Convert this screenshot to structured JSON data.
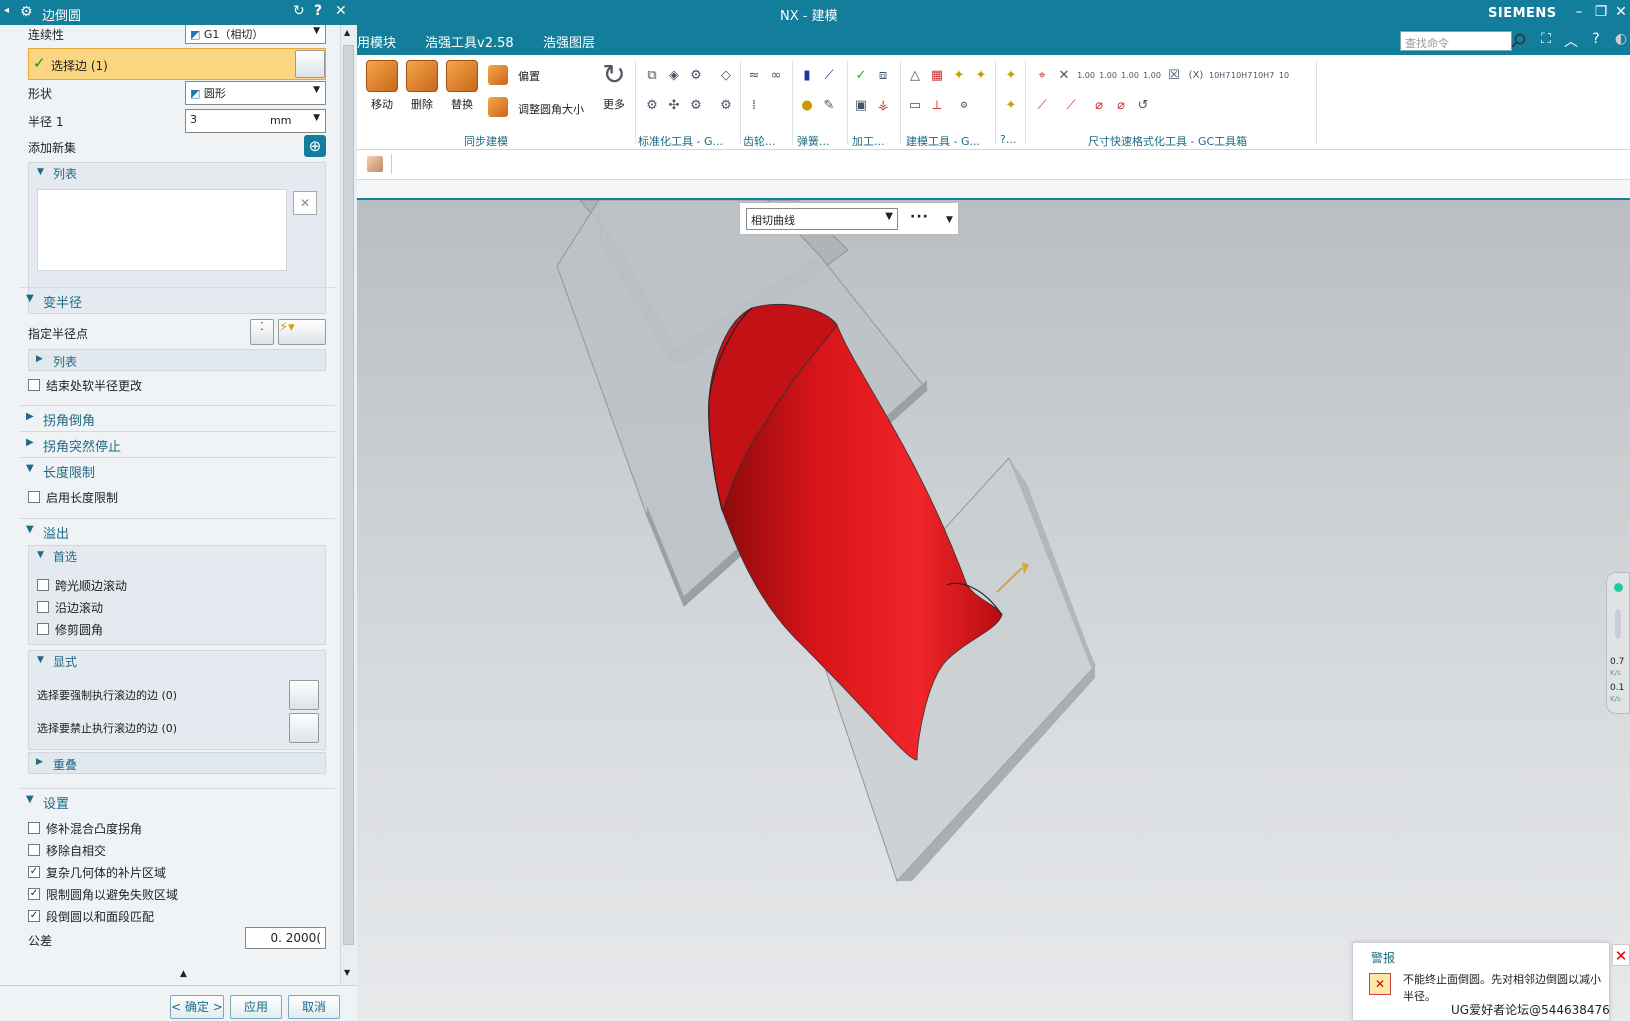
{
  "window": {
    "title": "NX - 建模",
    "brand": "SIEMENS"
  },
  "menu": {
    "tabs": [
      "用模块",
      "浩强工具v2.58",
      "浩强图层"
    ],
    "search_placeholder": "查找命令"
  },
  "ribbon": {
    "big_buttons": [
      "移动",
      "删除",
      "替换"
    ],
    "small_buttons": [
      "偏置",
      "调整圆角大小"
    ],
    "more": "更多",
    "groups": [
      "同步建模",
      "标准化工具 - G...",
      "齿轮...",
      "弹簧...",
      "加工...",
      "建模工具 - G...",
      "?...",
      "尺寸快速格式化工具 - GC工具箱"
    ]
  },
  "selection_bar": {
    "filter": "相切曲线",
    "more": "···"
  },
  "dialog": {
    "title": "边倒圆",
    "continuity_label": "连续性",
    "continuity_value": "G1（相切）",
    "select_edge_label": "选择边 (1)",
    "shape_label": "形状",
    "shape_value": "圆形",
    "radius_label": "半径 1",
    "radius_value": "3",
    "radius_unit": "mm",
    "add_set_label": "添加新集",
    "list_label": "列表",
    "var_radius": {
      "title": "变半径",
      "specify_points": "指定半径点",
      "list": "列表",
      "smooth": "结束处软半径更改"
    },
    "corner_setback": "拐角倒角",
    "corner_stop": "拐角突然停止",
    "length_limit": {
      "title": "长度限制",
      "enable": "启用长度限制"
    },
    "overflow": {
      "title": "溢出",
      "preferred": "首选",
      "opt1": "跨光顺边滚动",
      "opt2": "沿边滚动",
      "opt3": "修剪圆角",
      "explicit": "显式",
      "force_label": "选择要强制执行滚边的边 (0)",
      "forbid_label": "选择要禁止执行滚边的边 (0)",
      "overlap": "重叠"
    },
    "settings": {
      "title": "设置",
      "s1": "修补混合凸度拐角",
      "s2": "移除自相交",
      "s3": "复杂几何体的补片区域",
      "s4": "限制圆角以避免失败区域",
      "s5": "段倒圆以和面段匹配",
      "tolerance_label": "公差",
      "tolerance_value": "0. 2000("
    },
    "buttons": {
      "ok": "< 确定 >",
      "apply": "应用",
      "cancel": "取消"
    }
  },
  "alert": {
    "title": "警报",
    "message": "不能终止面倒圆。先对相邻边倒圆以减小半径。"
  },
  "watermark": "UG爱好者论坛@544638476",
  "gauge": {
    "v1": "0.7",
    "v2": "0.1",
    "unit": "K/s"
  },
  "colors": {
    "brand": "#127e9b",
    "fillet": "#d40f14",
    "selection": "#fbd680"
  }
}
